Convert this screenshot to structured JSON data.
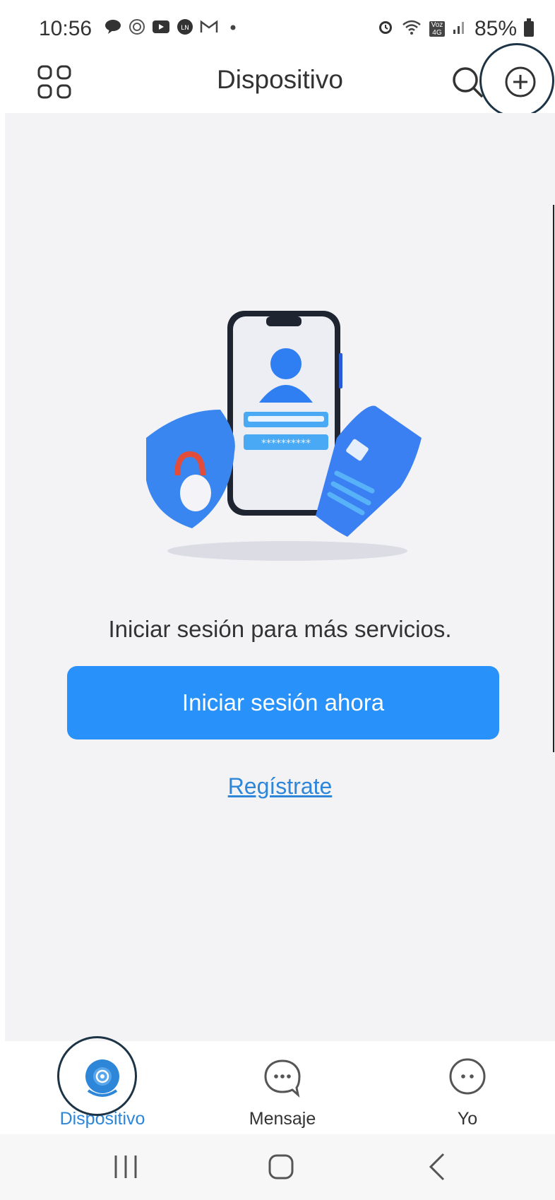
{
  "status_bar": {
    "time": "10:56",
    "network": "Voz 4G",
    "battery": "85%",
    "left_icons": [
      "chat-bubble-icon",
      "tv-icon",
      "youtube-icon",
      "ln-icon",
      "gmail-icon",
      "dot-icon"
    ],
    "right_icons": [
      "alarm-icon",
      "wifi-icon",
      "volte-icon",
      "signal-icon",
      "battery-icon"
    ]
  },
  "header": {
    "title": "Dispositivo"
  },
  "main": {
    "prompt": "Iniciar sesión para más servicios.",
    "login_button": "Iniciar sesión ahora",
    "register_link": "Regístrate",
    "illustration": {
      "password_mask": "**********"
    }
  },
  "bottom_nav": {
    "items": [
      {
        "label": "Dispositivo",
        "icon": "device-camera-icon",
        "active": true
      },
      {
        "label": "Mensaje",
        "icon": "message-icon",
        "active": false
      },
      {
        "label": "Yo",
        "icon": "profile-icon",
        "active": false
      }
    ]
  },
  "colors": {
    "accent": "#2891fa",
    "link": "#2e86d9",
    "background": "#f3f3f6",
    "annotation_ring": "#1c3446"
  }
}
